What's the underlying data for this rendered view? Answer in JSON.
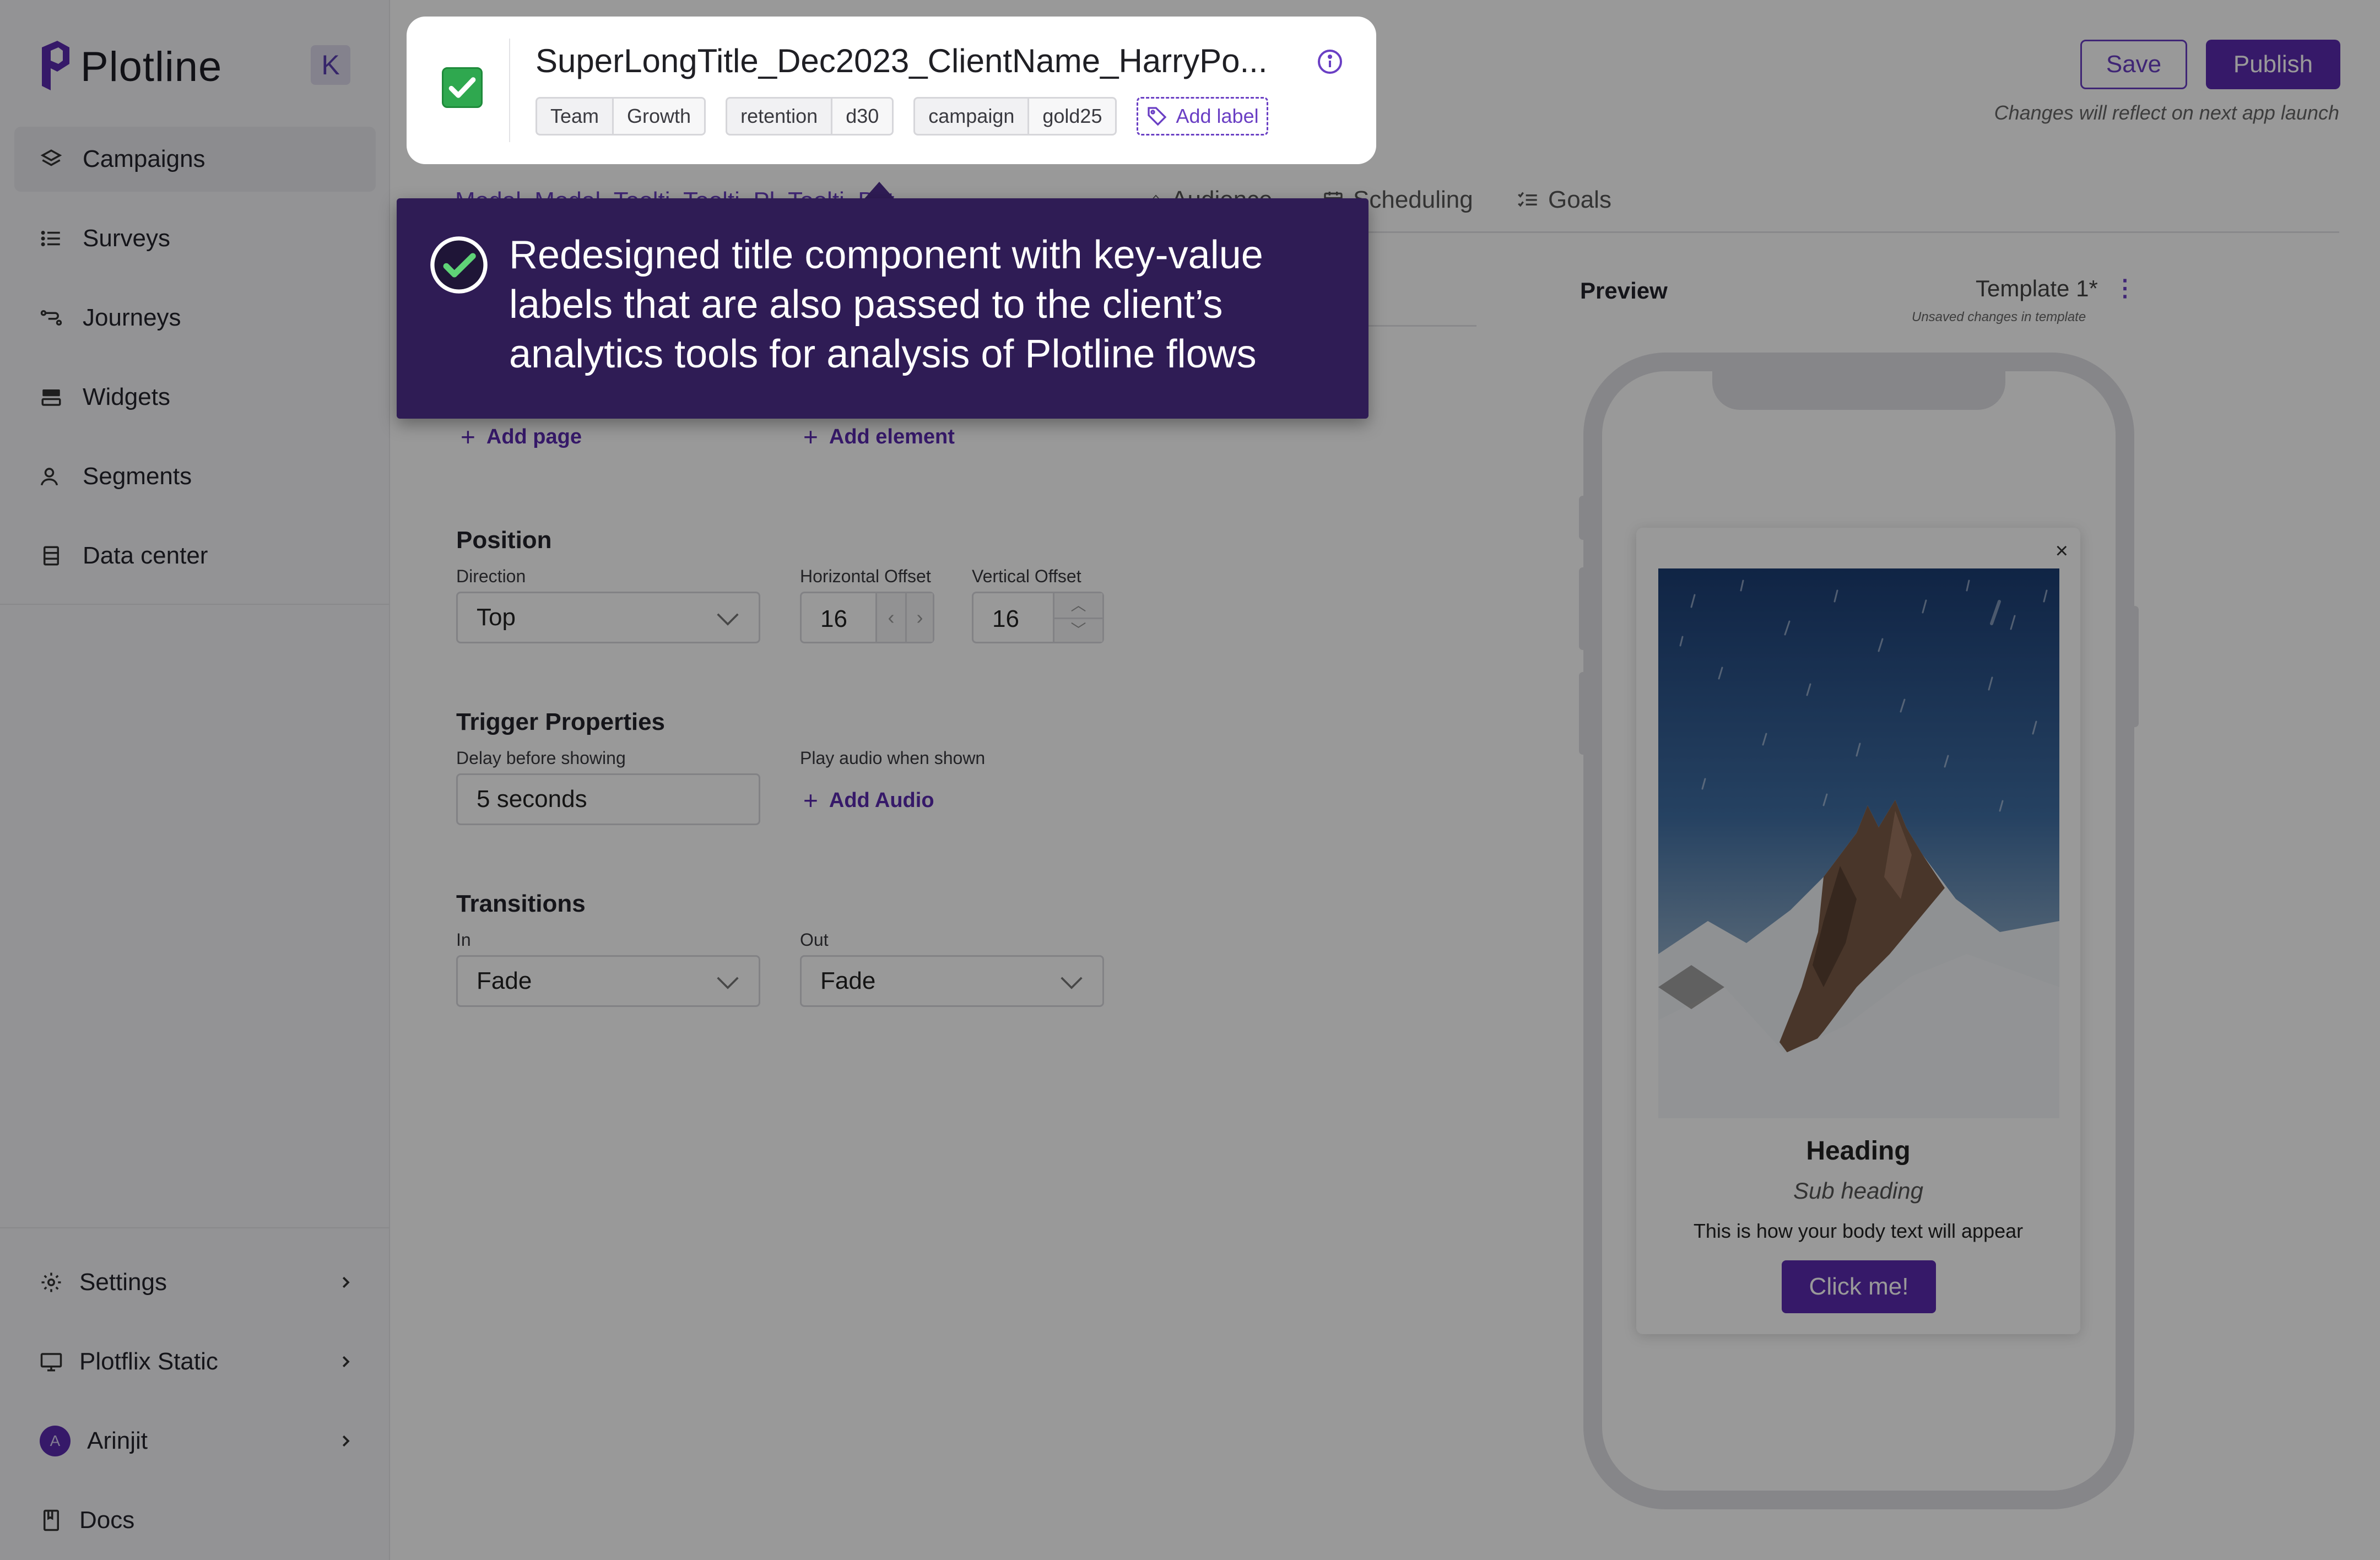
{
  "sidebar": {
    "brand": "Plotline",
    "collapse_key": "K",
    "nav": [
      {
        "label": "Campaigns",
        "icon": "layers-icon",
        "active": true
      },
      {
        "label": "Surveys",
        "icon": "list-icon"
      },
      {
        "label": "Journeys",
        "icon": "route-icon"
      },
      {
        "label": "Widgets",
        "icon": "widget-icon"
      },
      {
        "label": "Segments",
        "icon": "users-icon"
      },
      {
        "label": "Data center",
        "icon": "database-icon"
      }
    ],
    "bottom": [
      {
        "label": "Settings",
        "icon": "gear-icon"
      },
      {
        "label": "Plotflix Static",
        "icon": "monitor-icon"
      },
      {
        "label": "Arinjit",
        "avatar": "A"
      },
      {
        "label": "Docs",
        "icon": "book-icon"
      }
    ]
  },
  "header": {
    "save_label": "Save",
    "publish_label": "Publish",
    "publish_hint": "Changes will reflect on next app launch"
  },
  "title_card": {
    "title": "SuperLongTitle_Dec2023_ClientName_HarryPo...",
    "labels": [
      {
        "key": "Team",
        "value": "Growth"
      },
      {
        "key": "retention",
        "value": "d30"
      },
      {
        "key": "campaign",
        "value": "gold25"
      }
    ],
    "add_label": "Add label"
  },
  "tabs": {
    "obscured": "Modal  Modal  Toolti  Toolti  Pl  Toolti  Bot",
    "audience": "Audience",
    "scheduling": "Scheduling",
    "goals": "Goals"
  },
  "callout": {
    "text": "Redesigned title component with key-value labels that are also passed to the client’s analytics tools for analysis of Plotline flows"
  },
  "editor": {
    "add_page": "Add page",
    "add_element": "Add element",
    "position": {
      "title": "Position",
      "direction_label": "Direction",
      "direction_value": "Top",
      "h_offset_label": "Horizontal Offset",
      "h_offset_value": "16",
      "v_offset_label": "Vertical Offset",
      "v_offset_value": "16"
    },
    "trigger": {
      "title": "Trigger Properties",
      "delay_label": "Delay before showing",
      "delay_value": "5 seconds",
      "audio_label": "Play audio when shown",
      "add_audio": "Add Audio"
    },
    "transitions": {
      "title": "Transitions",
      "in_label": "In",
      "in_value": "Fade",
      "out_label": "Out",
      "out_value": "Fade"
    }
  },
  "preview": {
    "title": "Preview",
    "template_name": "Template 1*",
    "template_note": "Unsaved changes in template",
    "card": {
      "close": "×",
      "heading": "Heading",
      "subheading": "Sub heading",
      "body": "This is how your body text will appear",
      "cta": "Click me!"
    }
  },
  "colors": {
    "brand": "#5b2bb0",
    "callout_bg": "#2f1c55",
    "check_green": "#2fa84f"
  }
}
